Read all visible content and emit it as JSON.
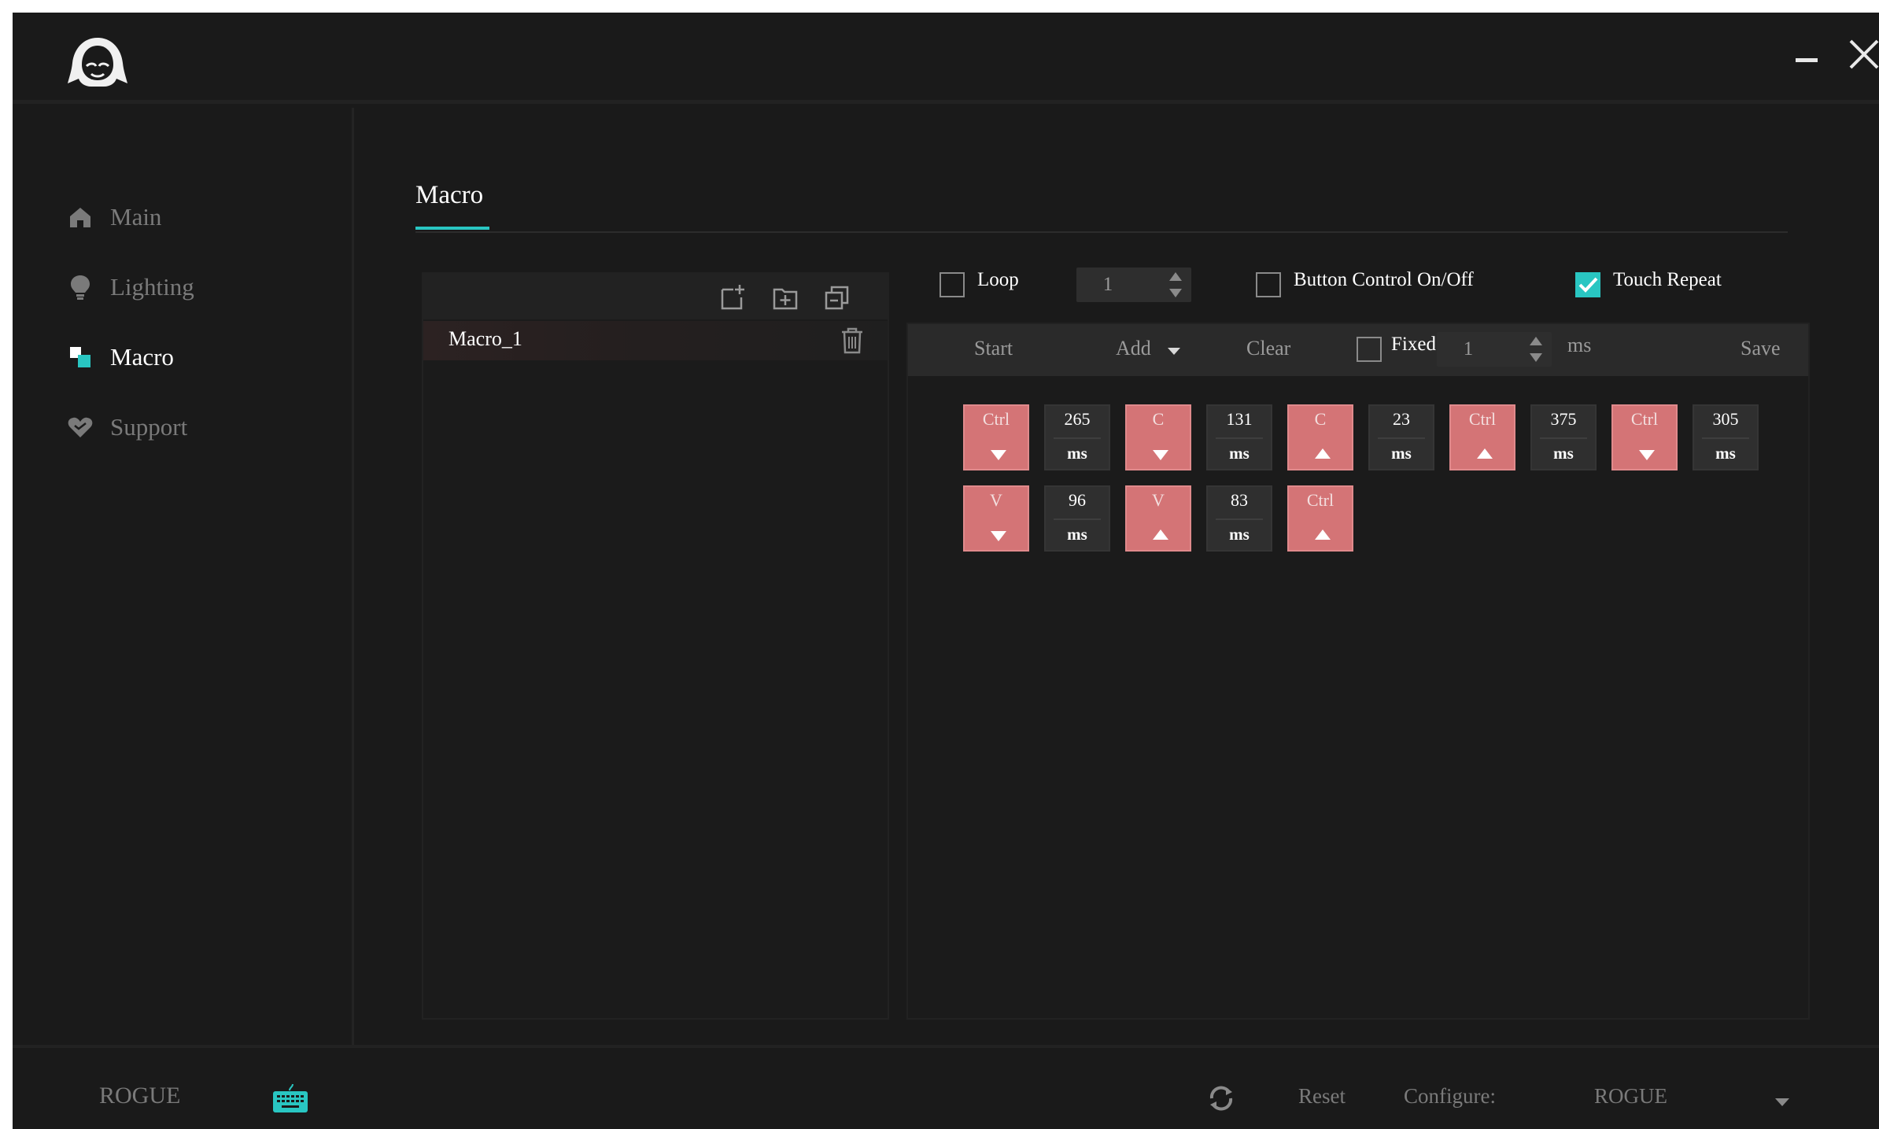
{
  "window": {
    "logo_icon": "hooded-figure-logo-icon",
    "minimize_icon": "minimize-icon",
    "close_icon": "close-icon"
  },
  "sidebar": {
    "items": [
      {
        "label": "Main",
        "icon": "home-icon",
        "active": false
      },
      {
        "label": "Lighting",
        "icon": "lightbulb-icon",
        "active": false
      },
      {
        "label": "Macro",
        "icon": "macro-icon",
        "active": true
      },
      {
        "label": "Support",
        "icon": "heart-icon",
        "active": false
      }
    ],
    "accent_color": "#29c6c2"
  },
  "main": {
    "title": "Macro"
  },
  "macro_list": {
    "toolbar_icons": [
      "new-macro-icon",
      "import-folder-icon",
      "copy-icon"
    ],
    "items": [
      {
        "name": "Macro_1",
        "selected": true
      }
    ],
    "delete_icon": "trash-icon"
  },
  "options": {
    "loop_label": "Loop",
    "loop_checked": false,
    "loop_count": "1",
    "button_control_label": "Button Control On/Off",
    "button_control_checked": false,
    "touch_repeat_label": "Touch Repeat",
    "touch_repeat_checked": true
  },
  "editor_toolbar": {
    "start_label": "Start",
    "add_label": "Add",
    "clear_label": "Clear",
    "fixed_label": "Fixed",
    "fixed_checked": false,
    "fixed_value": "1",
    "fixed_unit": "ms",
    "save_label": "Save"
  },
  "sequence": [
    {
      "type": "key",
      "key": "Ctrl",
      "direction": "down"
    },
    {
      "type": "delay",
      "value": "265",
      "unit": "ms"
    },
    {
      "type": "key",
      "key": "C",
      "direction": "down"
    },
    {
      "type": "delay",
      "value": "131",
      "unit": "ms"
    },
    {
      "type": "key",
      "key": "C",
      "direction": "up"
    },
    {
      "type": "delay",
      "value": "23",
      "unit": "ms"
    },
    {
      "type": "key",
      "key": "Ctrl",
      "direction": "up"
    },
    {
      "type": "delay",
      "value": "375",
      "unit": "ms"
    },
    {
      "type": "key",
      "key": "Ctrl",
      "direction": "down"
    },
    {
      "type": "delay",
      "value": "305",
      "unit": "ms"
    },
    {
      "type": "key",
      "key": "V",
      "direction": "down"
    },
    {
      "type": "delay",
      "value": "96",
      "unit": "ms"
    },
    {
      "type": "key",
      "key": "V",
      "direction": "up"
    },
    {
      "type": "delay",
      "value": "83",
      "unit": "ms"
    },
    {
      "type": "key",
      "key": "Ctrl",
      "direction": "up"
    }
  ],
  "footer": {
    "device_name": "ROGUE",
    "device_icon": "keyboard-icon",
    "refresh_icon": "refresh-icon",
    "reset_label": "Reset",
    "configure_label": "Configure:",
    "configure_value": "ROGUE"
  },
  "colors": {
    "background": "#1a1a1a",
    "accent": "#29c6c2",
    "key_block": "#d47476",
    "delay_block": "#2f2f2f"
  }
}
